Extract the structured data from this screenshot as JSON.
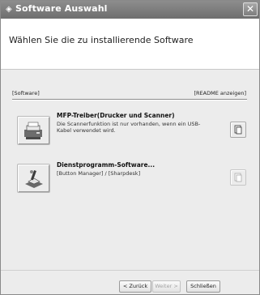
{
  "window": {
    "title": "Software Auswahl",
    "title_icon": "disc-icon",
    "close_glyph": "✕"
  },
  "header": {
    "heading": "Wählen Sie die zu installierende Software"
  },
  "section": {
    "left_label": "[Software]",
    "right_label": "[README anzeigen]"
  },
  "items": [
    {
      "title": "MFP-Treiber(Drucker und Scanner)",
      "description": "Die Scannerfunktion ist nur vorhanden, wenn ein USB-Kabel verwendet wird.",
      "icon": "printer-scanner-icon",
      "readme_enabled": true
    },
    {
      "title": "Dienstprogramm-Software...",
      "description": "[Button Manager] / [Sharpdesk]",
      "icon": "utility-software-icon",
      "readme_enabled": false
    }
  ],
  "footer": {
    "back_label": "< Zurück",
    "next_label": "Weiter >",
    "close_label": "Schließen"
  },
  "colors": {
    "titlebar": "#7d7d7d",
    "background": "#ececec",
    "header_bg": "#ffffff"
  }
}
